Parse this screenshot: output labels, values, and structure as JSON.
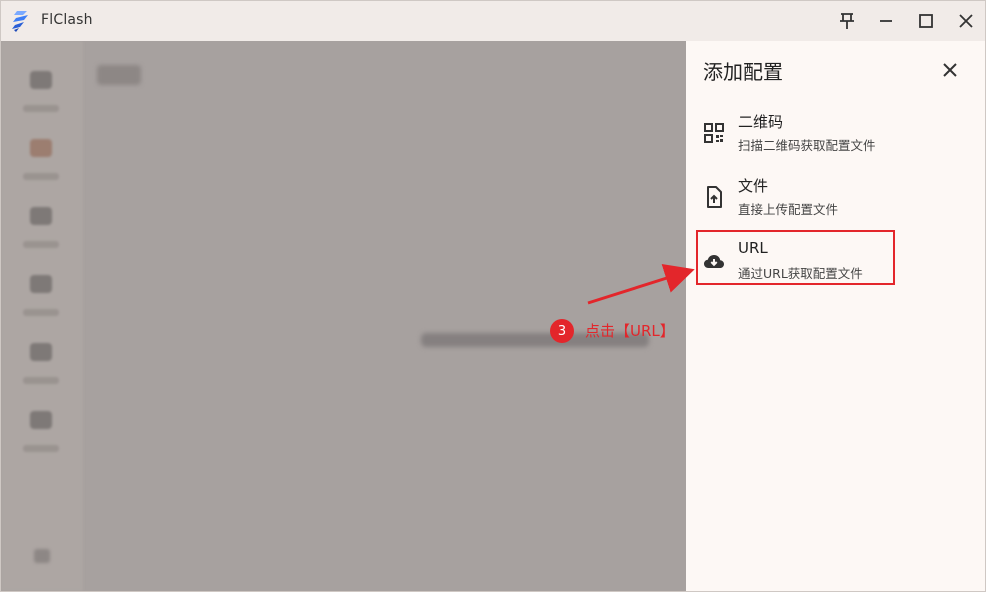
{
  "window": {
    "title": "FlClash"
  },
  "sheet": {
    "title": "添加配置",
    "options": [
      {
        "title": "二维码",
        "subtitle": "扫描二维码获取配置文件",
        "icon": "qr-code-icon"
      },
      {
        "title": "文件",
        "subtitle": "直接上传配置文件",
        "icon": "file-upload-icon"
      },
      {
        "title": "URL",
        "subtitle": "通过URL获取配置文件",
        "icon": "cloud-download-icon"
      }
    ]
  },
  "annotation": {
    "step": "3",
    "text": "点击【URL】",
    "color": "#e3262b"
  },
  "colors": {
    "titlebar": "#f1ebe8",
    "sheet_bg": "#fdf8f5",
    "scrim": "#a7a19f",
    "logo_blue": "#3d7df5"
  }
}
